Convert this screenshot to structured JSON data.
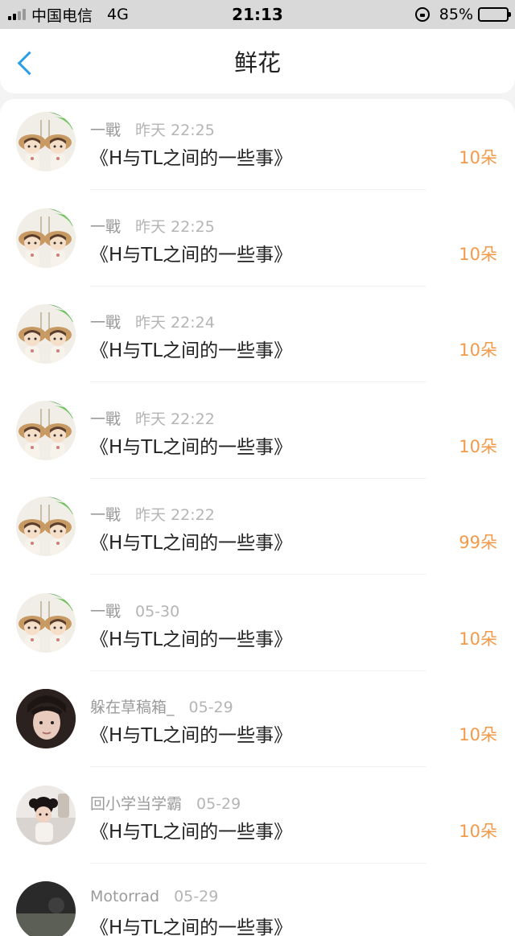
{
  "status_bar": {
    "carrier": "中国电信",
    "network": "4G",
    "time": "21:13",
    "battery": "85%",
    "battery_level": 0.85
  },
  "nav": {
    "title": "鲜花"
  },
  "rows": [
    {
      "user": "一戰",
      "time": "昨天 22:25",
      "title": "《H与TL之间的一些事》",
      "amount": "10朵",
      "avatar": "couple"
    },
    {
      "user": "一戰",
      "time": "昨天 22:25",
      "title": "《H与TL之间的一些事》",
      "amount": "10朵",
      "avatar": "couple"
    },
    {
      "user": "一戰",
      "time": "昨天 22:24",
      "title": "《H与TL之间的一些事》",
      "amount": "10朵",
      "avatar": "couple"
    },
    {
      "user": "一戰",
      "time": "昨天 22:22",
      "title": "《H与TL之间的一些事》",
      "amount": "10朵",
      "avatar": "couple"
    },
    {
      "user": "一戰",
      "time": "昨天 22:22",
      "title": "《H与TL之间的一些事》",
      "amount": "99朵",
      "avatar": "couple"
    },
    {
      "user": "一戰",
      "time": "05-30",
      "title": "《H与TL之间的一些事》",
      "amount": "10朵",
      "avatar": "couple"
    },
    {
      "user": "躲在草稿箱_",
      "time": "05-29",
      "title": "《H与TL之间的一些事》",
      "amount": "10朵",
      "avatar": "girl"
    },
    {
      "user": "回小学当学霸",
      "time": "05-29",
      "title": "《H与TL之间的一些事》",
      "amount": "10朵",
      "avatar": "kid"
    },
    {
      "user": "Motorrad",
      "time": "05-29",
      "title": "《H与TL之间的一些事》",
      "amount": "",
      "avatar": "dark"
    }
  ],
  "colors": {
    "accent": "#2a9ee8",
    "amount": "#f39a4a"
  }
}
